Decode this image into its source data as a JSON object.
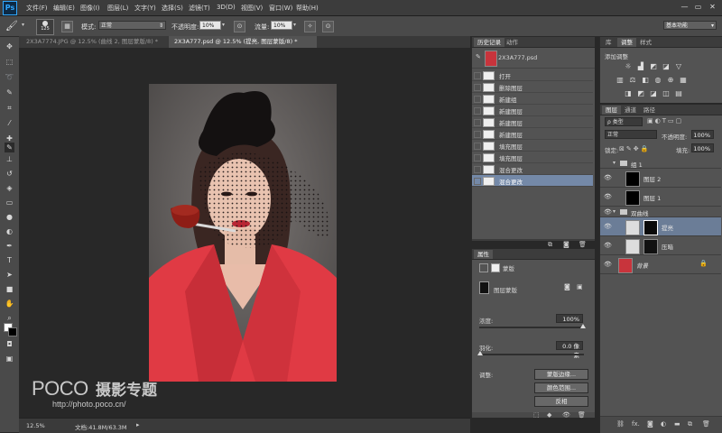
{
  "menubar": {
    "logo": "Ps",
    "items": [
      "文件(F)",
      "编辑(E)",
      "图像(I)",
      "图层(L)",
      "文字(Y)",
      "选择(S)",
      "滤镜(T)",
      "3D(D)",
      "视图(V)",
      "窗口(W)",
      "帮助(H)"
    ],
    "window_buttons": [
      "—",
      "▭",
      "✕"
    ]
  },
  "options": {
    "brush_size": "125",
    "mode_label": "模式:",
    "mode_value": "正常",
    "opacity_label": "不透明度:",
    "opacity_value": "10%",
    "flow_label": "流量:",
    "flow_value": "10%",
    "workspace": "基本功能"
  },
  "tabs": {
    "doc1": "2X3A7774.JPG @ 12.5% (曲线 2, 图层蒙版/8) *",
    "doc2": "2X3A777.psd @ 12.5% (提亮, 图层蒙版/8) *"
  },
  "status": {
    "zoom": "12.5%",
    "doc_info": "文档:41.8M/63.3M"
  },
  "watermark": {
    "brand": "POCO",
    "slogan": "摄影专题",
    "url": "http://photo.poco.cn/"
  },
  "history": {
    "tabs": [
      "历史记录",
      "动作"
    ],
    "snapshot": "2X3A777.psd",
    "items": [
      "打开",
      "删除图层",
      "新建组",
      "新建图层",
      "新建图层",
      "新建图层",
      "填充图层",
      "填充图层",
      "混合更改",
      "混合更改"
    ]
  },
  "adjustments": {
    "tabs": [
      "库",
      "调整",
      "样式"
    ],
    "title": "添加调整"
  },
  "layers_panel": {
    "tabs": [
      "图层",
      "通道",
      "路径"
    ],
    "kind": "ρ 类型",
    "blend_mode": "正常",
    "opacity_label": "不透明度:",
    "opacity_value": "100%",
    "lock_label": "锁定:",
    "fill_label": "填充:",
    "fill_value": "100%",
    "group1": "组 1",
    "layer2": "图层 2",
    "layer1": "图层 1",
    "group2": "双曲线",
    "brighten": "提亮",
    "darken": "压暗",
    "background": "背景"
  },
  "properties": {
    "tab": "属性",
    "mask_tab": "蒙版",
    "mask_type": "图层蒙版",
    "density_label": "浓度:",
    "density_value": "100%",
    "feather_label": "羽化:",
    "feather_value": "0.0 像素",
    "adjust_label": "调整:",
    "btn_edge": "蒙版边缘...",
    "btn_color": "颜色范围...",
    "btn_invert": "反相"
  },
  "colors": {
    "accent": "#31a8ff",
    "selection": "#7489a8",
    "jacket": "#e03a44"
  }
}
